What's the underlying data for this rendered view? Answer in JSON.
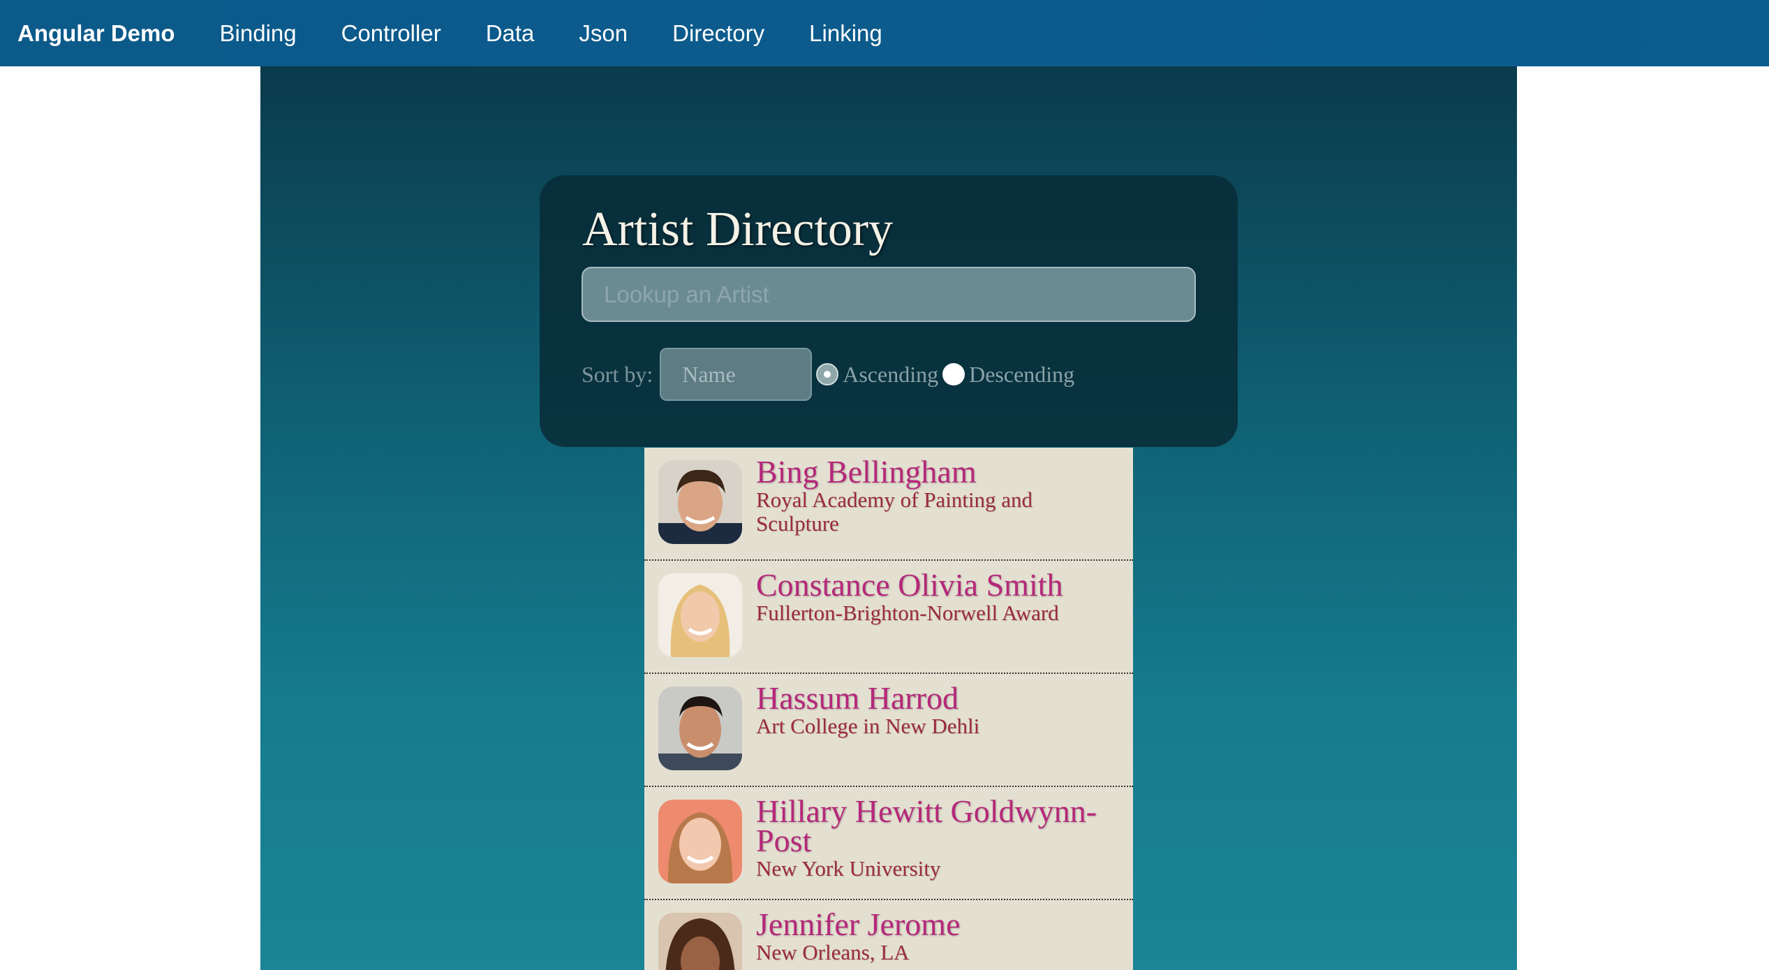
{
  "navbar": {
    "brand": "Angular Demo",
    "links": [
      "Binding",
      "Controller",
      "Data",
      "Json",
      "Directory",
      "Linking"
    ]
  },
  "directory": {
    "title": "Artist Directory",
    "search_placeholder": "Lookup an Artist",
    "sort_label": "Sort by:",
    "sort_value": "Name",
    "ascending_label": "Ascending",
    "descending_label": "Descending",
    "ascending_checked": true
  },
  "artists": [
    {
      "name": "Bing Bellingham",
      "school": "Royal Academy of Painting and Sculpture"
    },
    {
      "name": "Constance Olivia Smith",
      "school": "Fullerton-Brighton-Norwell Award"
    },
    {
      "name": "Hassum Harrod",
      "school": "Art College in New Dehli"
    },
    {
      "name": "Hillary Hewitt Goldwynn-Post",
      "school": "New York University"
    },
    {
      "name": "Jennifer Jerome",
      "school": "New Orleans, LA"
    }
  ],
  "colors": {
    "navbar": "#0b5c8f",
    "panel": "#082c38",
    "name_text": "#b5287a",
    "sub_text": "#9b2b3e",
    "item_bg": "#e4e0d1"
  }
}
